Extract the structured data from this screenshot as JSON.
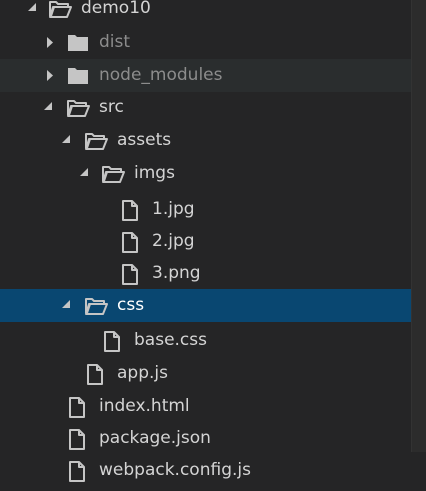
{
  "colors": {
    "background": "#252526",
    "selected_row": "#094771",
    "hover_row": "#2a2d2e",
    "text_normal": "#d4d4d4",
    "text_dimmed": "#8c8c8c",
    "text_selected": "#ffffff",
    "icon": "#c5c5c5"
  },
  "tree": {
    "items": [
      {
        "label": "demo10",
        "type": "folder",
        "expanded": true,
        "depth": 0,
        "dimmed": false
      },
      {
        "label": "dist",
        "type": "folder",
        "expanded": false,
        "depth": 1,
        "dimmed": true
      },
      {
        "label": "node_modules",
        "type": "folder",
        "expanded": false,
        "depth": 1,
        "dimmed": true
      },
      {
        "label": "src",
        "type": "folder",
        "expanded": true,
        "depth": 1,
        "dimmed": false
      },
      {
        "label": "assets",
        "type": "folder",
        "expanded": true,
        "depth": 2,
        "dimmed": false
      },
      {
        "label": "imgs",
        "type": "folder",
        "expanded": true,
        "depth": 3,
        "dimmed": false
      },
      {
        "label": "1.jpg",
        "type": "file",
        "depth": 4,
        "dimmed": false
      },
      {
        "label": "2.jpg",
        "type": "file",
        "depth": 4,
        "dimmed": false
      },
      {
        "label": "3.png",
        "type": "file",
        "depth": 4,
        "dimmed": false
      },
      {
        "label": "css",
        "type": "folder",
        "expanded": true,
        "depth": 2,
        "dimmed": false,
        "selected": true
      },
      {
        "label": "base.css",
        "type": "file",
        "depth": 3,
        "dimmed": false
      },
      {
        "label": "app.js",
        "type": "file",
        "depth": 2,
        "dimmed": false
      },
      {
        "label": "index.html",
        "type": "file",
        "depth": 1,
        "dimmed": false
      },
      {
        "label": "package.json",
        "type": "file",
        "depth": 1,
        "dimmed": false
      },
      {
        "label": "webpack.config.js",
        "type": "file",
        "depth": 1,
        "dimmed": false
      }
    ]
  }
}
